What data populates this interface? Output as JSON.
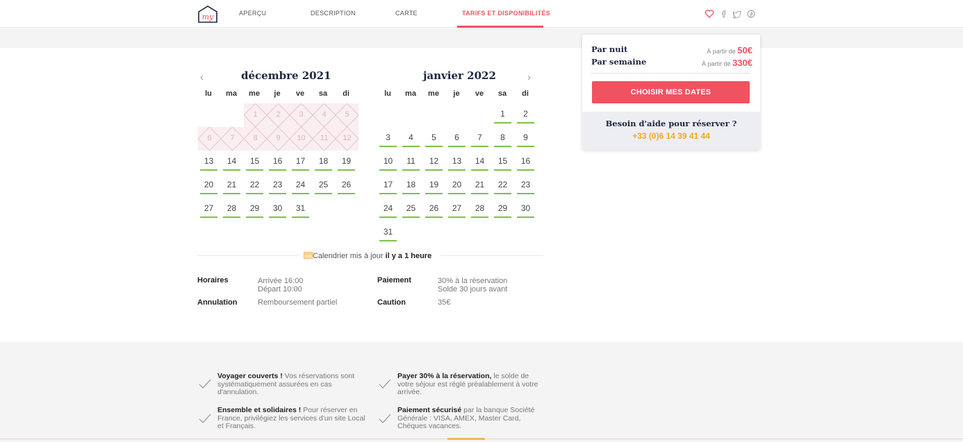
{
  "nav": {
    "tabs": [
      {
        "label": "APERÇU"
      },
      {
        "label": "DESCRIPTION"
      },
      {
        "label": "CARTE"
      },
      {
        "label": "TARIFS ET DISPONIBILITÉS",
        "active": true
      }
    ],
    "logo_text": "my",
    "icons": [
      "heart-icon",
      "facebook-icon",
      "twitter-icon",
      "pinterest-icon"
    ]
  },
  "calendar": {
    "months": [
      {
        "name": "décembre 2021"
      },
      {
        "name": "janvier 2022"
      }
    ],
    "weekdays": [
      "lu",
      "ma",
      "me",
      "je",
      "ve",
      "sa",
      "di"
    ],
    "december": {
      "unavailable_days": [
        1,
        2,
        3,
        4,
        5,
        6,
        7,
        8,
        9,
        10,
        11,
        12
      ],
      "available_days": [
        13,
        14,
        15,
        16,
        17,
        18,
        19,
        20,
        21,
        22,
        23,
        24,
        25,
        26,
        27,
        28,
        29,
        30,
        31
      ]
    },
    "january": {
      "available_days": [
        1,
        2,
        3,
        4,
        5,
        6,
        7,
        8,
        9,
        10,
        11,
        12,
        13,
        14,
        15,
        16,
        17,
        18,
        19,
        20,
        21,
        22,
        23,
        24,
        25,
        26,
        27,
        28,
        29,
        30,
        31
      ]
    },
    "update_prefix": "Calendrier mis à jour ",
    "update_time": "il y a 1 heure"
  },
  "info": {
    "horaires_label": "Horaires",
    "arrivee": "Arrivée 16:00",
    "depart": "Départ 10:00",
    "annulation_label": "Annulation",
    "annulation_value": "Remboursement partiel",
    "paiement_label": "Paiement",
    "paiement_line1": "30% à la réservation",
    "paiement_line2": "Solde 30 jours avant",
    "caution_label": "Caution",
    "caution_value": "35€"
  },
  "booking": {
    "night_label": "Par nuit",
    "week_label": "Par semaine",
    "from_label": "À partir de",
    "night_price": "50€",
    "week_price": "330€",
    "button_label": "CHOISIR MES DATES",
    "help_title": "Besoin d'aide pour réserver ?",
    "help_phone": "+33 (0)6 14 39 41 44"
  },
  "perks": [
    {
      "bold": "Voyager couverts !",
      "text": " Vos réservations sont systématiquement assurées en cas d'annulation."
    },
    {
      "bold": "Payer 30% à la réservation,",
      "text": " le solde de votre séjour est réglé préalablement à votre arrivée."
    },
    {
      "bold": "Ensemble et solidaires !",
      "text": " Pour réserver en France, privilégiez les services d'un site Local et Français."
    },
    {
      "bold": "Paiement sécurisé",
      "text": " par la banque Société Générale : VISA, AMEX, Master Card, Chèques vacances."
    }
  ],
  "colors": {
    "accent": "#f0525f",
    "available": "#7cc242",
    "navy": "#1c2541",
    "phone": "#f5a623"
  }
}
